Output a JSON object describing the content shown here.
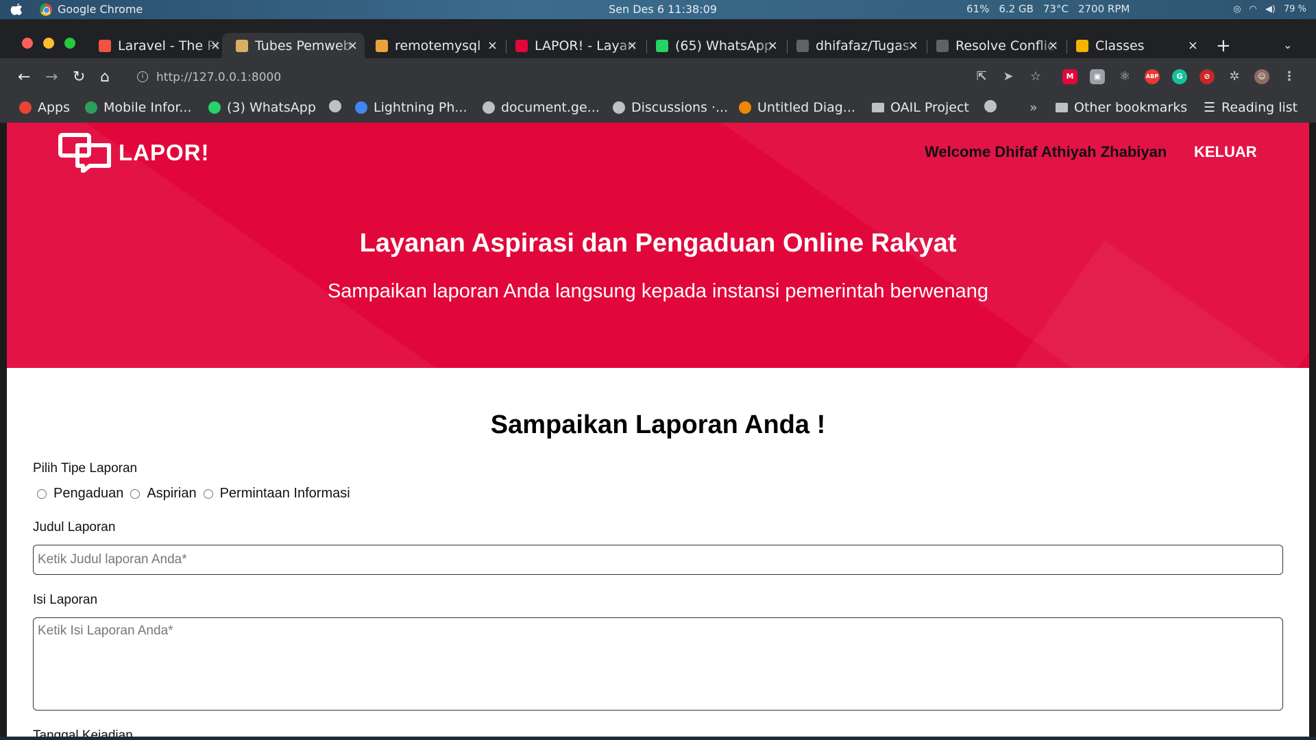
{
  "system": {
    "app_name": "Google Chrome",
    "clock": "Sen Des 6  11:38:09",
    "stats": [
      "61%",
      "6.2 GB",
      "73°C",
      "2700 RPM"
    ],
    "battery": "79 %"
  },
  "tabs": [
    {
      "label": "Laravel - The PHP Framework",
      "color": "#f05340"
    },
    {
      "label": "Tubes Pemweb",
      "color": "#d8b060",
      "active": true
    },
    {
      "label": "remotemysql",
      "color": "#e8a33d"
    },
    {
      "label": "LAPOR! - Layanan",
      "color": "#e2073b"
    },
    {
      "label": "(65) WhatsApp",
      "color": "#25d366"
    },
    {
      "label": "dhifafaz/Tugas",
      "color": "#5f6368"
    },
    {
      "label": "Resolve Conflicts",
      "color": "#5f6368"
    },
    {
      "label": "Classes",
      "color": "#f4b400"
    }
  ],
  "toolbar": {
    "url": "http://127.0.0.1:8000"
  },
  "bookmarks": [
    {
      "label": "Apps",
      "color": "#ea4335"
    },
    {
      "label": "Mobile Infor...",
      "color": "#2e9e5b"
    },
    {
      "label": "(3) WhatsApp",
      "color": "#25d366"
    },
    {
      "label": "",
      "color": "#bdc1c6"
    },
    {
      "label": "Lightning Ph...",
      "color": "#4285f4"
    },
    {
      "label": "document.ge...",
      "color": "#bdc1c6"
    },
    {
      "label": "Discussions ·...",
      "color": "#bdc1c6"
    },
    {
      "label": "Untitled Diag...",
      "color": "#f08705"
    },
    {
      "label": "OAIL Project",
      "color": "folder"
    },
    {
      "label": "",
      "color": "#bdc1c6"
    }
  ],
  "bookmarks_more": "»",
  "other_bookmarks": "Other bookmarks",
  "reading_list": "Reading list",
  "page": {
    "logo_text": "LAPOR!",
    "welcome": "Welcome Dhifaf Athiyah Zhabiyan",
    "logout": "KELUAR",
    "hero_title": "Layanan Aspirasi dan Pengaduan Online Rakyat",
    "hero_subtitle": "Sampaikan laporan Anda langsung kepada instansi pemerintah berwenang",
    "form_title": "Sampaikan Laporan Anda !",
    "type_label": "Pilih Tipe Laporan",
    "type_options": [
      "Pengaduan",
      "Aspirian",
      "Permintaan Informasi"
    ],
    "title_label": "Judul Laporan",
    "title_placeholder": "Ketik Judul laporan Anda*",
    "content_label": "Isi Laporan",
    "content_placeholder": "Ketik Isi Laporan Anda*",
    "next_label": "Tanggal Kejadian"
  },
  "colors": {
    "brand_red": "#e2073b",
    "chrome_dark": "#35363a"
  }
}
